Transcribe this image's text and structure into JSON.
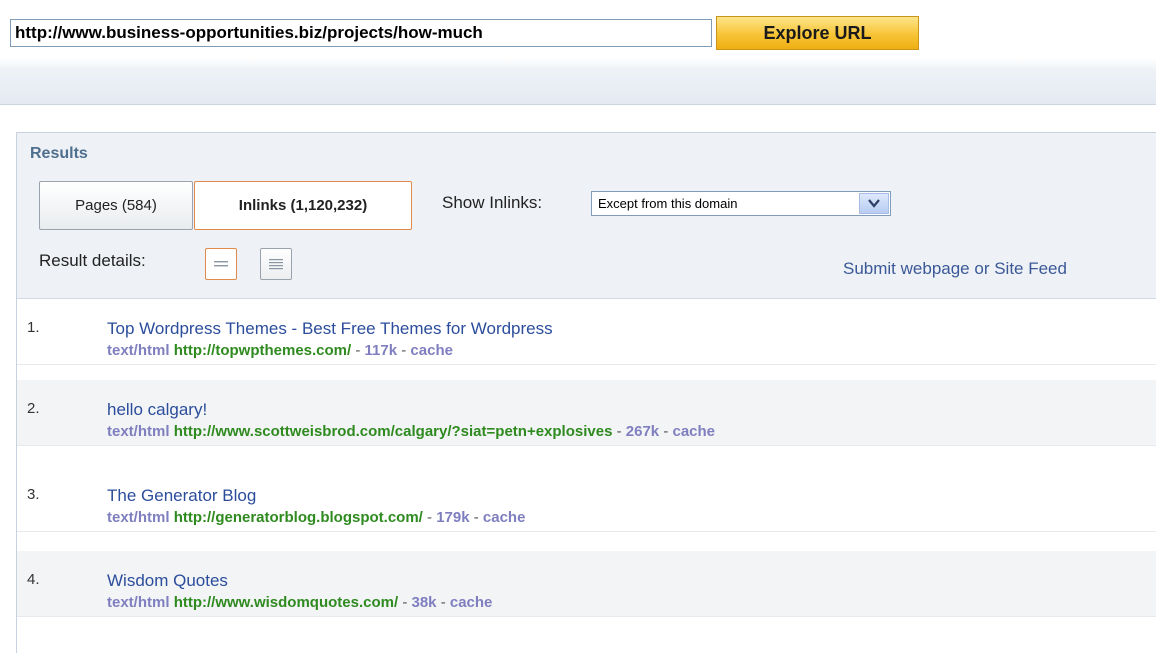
{
  "search": {
    "url_value": "http://www.business-opportunities.biz/projects/how-much",
    "explore_label": "Explore URL"
  },
  "results": {
    "title": "Results",
    "tabs": [
      {
        "label": "Pages (584)"
      },
      {
        "label": "Inlinks (1,120,232)"
      }
    ],
    "show_inlinks_label": "Show Inlinks:",
    "show_inlinks_selected": "Except from this domain",
    "result_details_label": "Result details:",
    "submit_link": "Submit webpage or Site Feed",
    "separator": "-",
    "items": [
      {
        "num": "1.",
        "title": "Top Wordpress Themes - Best Free Themes for Wordpress",
        "type": "text/html",
        "url": "http://topwpthemes.com/",
        "size": "117k",
        "cache": "cache"
      },
      {
        "num": "2.",
        "title": "hello calgary!",
        "type": "text/html",
        "url": "http://www.scottweisbrod.com/calgary/?siat=petn+explosives",
        "size": "267k",
        "cache": "cache"
      },
      {
        "num": "3.",
        "title": "The Generator Blog",
        "type": "text/html",
        "url": "http://generatorblog.blogspot.com/",
        "size": "179k",
        "cache": "cache"
      },
      {
        "num": "4.",
        "title": "Wisdom Quotes",
        "type": "text/html",
        "url": "http://www.wisdomquotes.com/",
        "size": "38k",
        "cache": "cache"
      }
    ]
  },
  "colors": {
    "explore_button": "#f7c436",
    "link_blue": "#2b4d9c",
    "url_green": "#2f8a1f",
    "meta_purple": "#7f7fc0",
    "active_tab_border": "#e28a4c"
  }
}
